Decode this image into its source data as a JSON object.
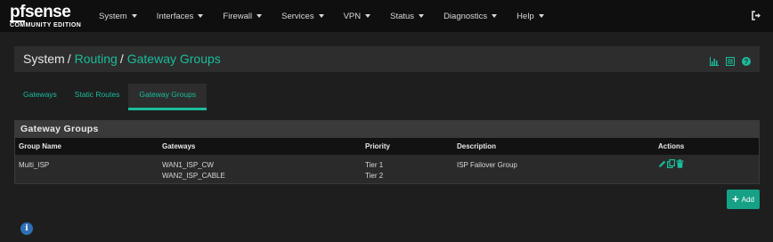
{
  "logo": {
    "main_pf": "pf",
    "main_rest": "sense",
    "sub": "COMMUNITY EDITION"
  },
  "nav": {
    "items": [
      {
        "label": "System"
      },
      {
        "label": "Interfaces"
      },
      {
        "label": "Firewall"
      },
      {
        "label": "Services"
      },
      {
        "label": "VPN"
      },
      {
        "label": "Status"
      },
      {
        "label": "Diagnostics"
      },
      {
        "label": "Help"
      }
    ],
    "logout_icon": "sign-out-icon"
  },
  "breadcrumb": {
    "root": "System",
    "sep": "/",
    "routing": "Routing",
    "current": "Gateway Groups",
    "icons": [
      "bar-chart-icon",
      "list-icon",
      "help-icon"
    ]
  },
  "tabs": [
    {
      "label": "Gateways",
      "active": false
    },
    {
      "label": "Static Routes",
      "active": false
    },
    {
      "label": "Gateway Groups",
      "active": true
    }
  ],
  "panel": {
    "title": "Gateway Groups",
    "columns": [
      "Group Name",
      "Gateways",
      "Priority",
      "Description",
      "Actions"
    ],
    "rows": [
      {
        "group_name": "Multi_ISP",
        "gateways": [
          "WAN1_ISP_CW",
          "WAN2_ISP_CABLE"
        ],
        "priority": [
          "Tier 1",
          "Tier 2"
        ],
        "description": "ISP Failover Group",
        "actions": [
          "pencil-icon",
          "copy-icon",
          "trash-icon"
        ]
      }
    ]
  },
  "add_button": {
    "label": "Add",
    "icon": "plus-icon"
  },
  "info_icon": "info-icon",
  "colors": {
    "accent": "#1abc9c",
    "button": "#16a085",
    "navbar": "#0f0f0f",
    "background": "#1e1e1e"
  }
}
